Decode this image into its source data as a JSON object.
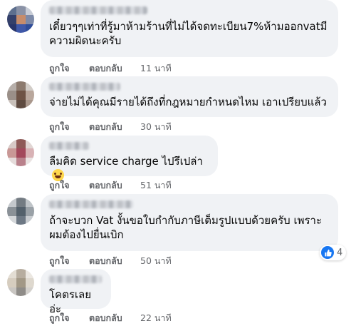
{
  "colors": {
    "bubble_bg": "#f0f2f5",
    "meta_text": "#65676b",
    "like_blue": "#1877f2"
  },
  "labels": {
    "like": "ถูกใจ",
    "reply": "ตอบกลับ"
  },
  "comments": [
    {
      "text": "เดี๋ยวๆๆเท่าที่รู้มาห้ามร้านที่ไม่ได้จดทะเบียน7%ห้ามออกvatมีความผิดนะครับ",
      "time": "11 นาที"
    },
    {
      "text": "จ่ายไม่ได้คุณมีรายได้ถึงที่กฎหมายกำหนดไหม เอาเปรียบแล้ว",
      "time": "30 นาที"
    },
    {
      "text": "ลืมคิด service charge ไปรึเปล่า",
      "emoji": "rolling-laughing-emoji",
      "time": "51 นาที"
    },
    {
      "text": "ถ้าจะบวก Vat งั้นขอใบกำกับภาษีเต็มรูปแบบด้วยครับ เพราะผมต้องไปยื่นเบิก",
      "time": "50 นาที",
      "reaction": {
        "icon": "thumbs-up-icon",
        "count": "4"
      }
    },
    {
      "text": "โคตรเลยอ่ะ",
      "time": "22 นาที"
    }
  ]
}
